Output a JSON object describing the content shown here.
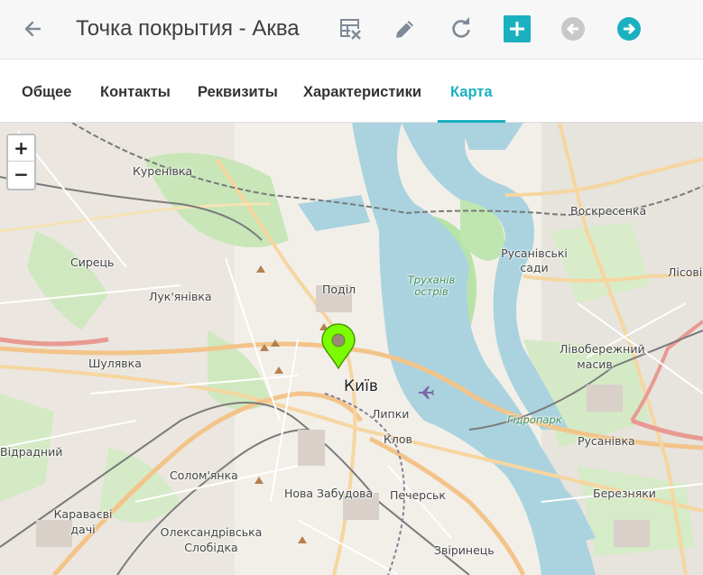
{
  "header": {
    "title": "Точка покрытия - Аква",
    "back_icon": "arrow-left-icon",
    "tools": [
      {
        "name": "table-remove-icon",
        "color": "#7f8a96"
      },
      {
        "name": "pencil-icon",
        "color": "#7f8a96"
      },
      {
        "name": "refresh-icon",
        "color": "#7f8a96"
      },
      {
        "name": "plus-icon",
        "color": "#1ab0c0"
      },
      {
        "name": "arrow-left-circle-icon",
        "color": "#c8c8c8"
      },
      {
        "name": "arrow-right-circle-icon",
        "color": "#1ab0c0"
      }
    ]
  },
  "tabs": [
    {
      "label": "Общее",
      "active": false
    },
    {
      "label": "Контакты",
      "active": false
    },
    {
      "label": "Реквизиты",
      "active": false
    },
    {
      "label": "Характеристики",
      "active": false
    },
    {
      "label": "Карта",
      "active": true
    }
  ],
  "map": {
    "zoom_in": "+",
    "zoom_out": "−",
    "marker_color": "#7cfc00",
    "labels": {
      "kurenivka": "Куренівка",
      "voskresenka": "Воскресенка",
      "syrets": "Сирець",
      "rusanivski_sady": "Русанівські сади",
      "podil": "Поділ",
      "lukianivka": "Лук'янівка",
      "lisova": "Лісові",
      "trukhaniv": "Труханів острів",
      "livoberezhnyi": "Лівобережний масив",
      "shuliavka": "Шулявка",
      "kyiv": "Київ",
      "lypky": "Липки",
      "hidropark": "Гідропарк",
      "klov": "Клов",
      "vidradnyi": "Відрадний",
      "rusanivka": "Русанівка",
      "solomianka": "Солом'янка",
      "nova_zabudova": "Нова Забудова",
      "pechersk": "Печерськ",
      "bereziaky": "Березняки",
      "karavaievi": "Караваєві дачі",
      "oleksandrivska": "Олександрівська Слобідка",
      "zvirynets": "Звіринець"
    }
  },
  "accent_color": "#1ab0c0"
}
